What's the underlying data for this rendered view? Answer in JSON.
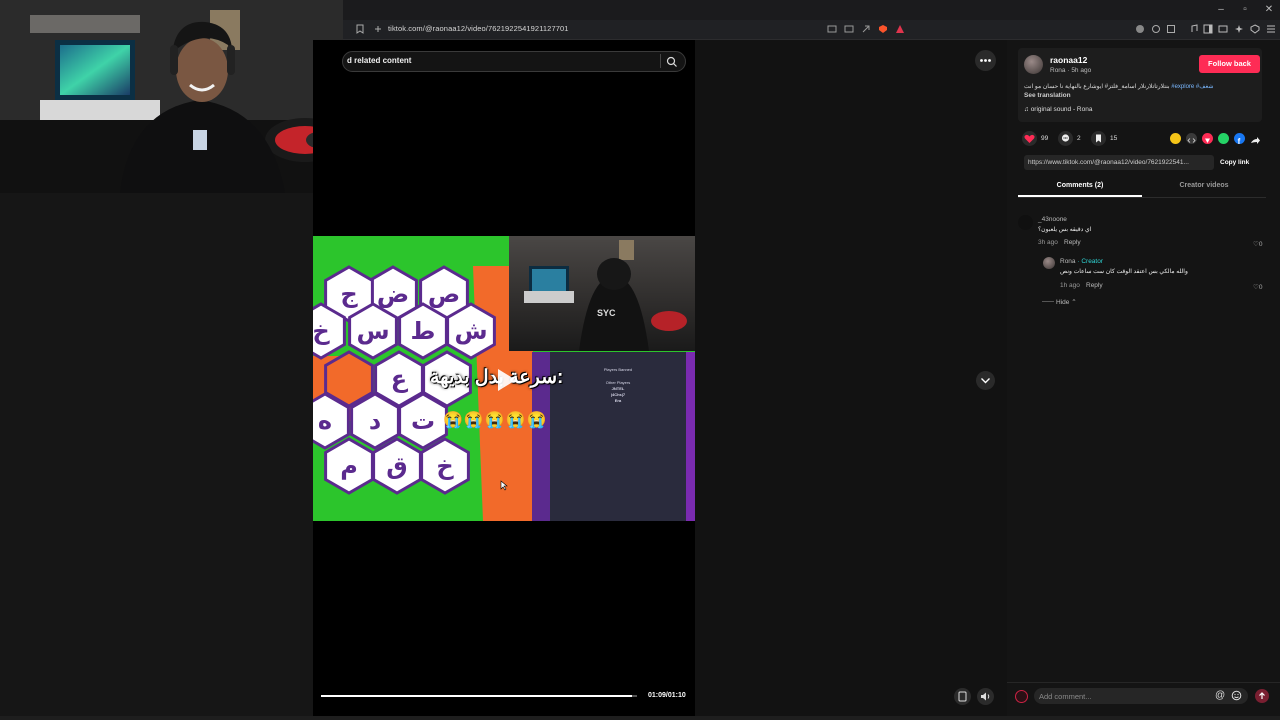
{
  "browser": {
    "url": "tiktok.com/@raonaa12/video/7621922541921127701",
    "window_controls": [
      "–",
      "▫",
      "✕"
    ]
  },
  "search": {
    "text": "d related content"
  },
  "video": {
    "caption_overlay": "سرعة بدل بديهة:",
    "emoji_row": "😭😭😭😭😭",
    "time": "01:09/01:10",
    "progress": 0.985,
    "game_letters": [
      "ض",
      "ص",
      "ج",
      "ش",
      "ط",
      "س",
      "خ",
      "ع",
      "ت",
      "د",
      "ه",
      "خ",
      "ق",
      "م"
    ],
    "players_panel": {
      "title": "Players Banned",
      "subtitle": "Other Players",
      "players": [
        "JNTEL",
        "|4Chs|7",
        "Era"
      ]
    },
    "cam_logo": "SYC"
  },
  "author": {
    "username": "raonaa12",
    "subline": "Rona · 5h ago",
    "follow_label": "Follow back",
    "description_plain": "بنتلارتاتلارنلار اسامة_فلتز# ايوشارع بالنهاية نا حسان مو انت ",
    "description_tags": "#explore #شغف",
    "see_translation": "See translation",
    "sound": "original sound - Rona"
  },
  "stats": {
    "likes": "99",
    "comments": "2",
    "saves": "15"
  },
  "share": {
    "link": "https://www.tiktok.com/@raonaa12/video/7621922541...",
    "copy_label": "Copy link",
    "colors": [
      "#f5c518",
      "#3a3a3a",
      "#fe2c55",
      "#25d366",
      "#1877f2"
    ]
  },
  "tabs": {
    "comments": "Comments (2)",
    "creator": "Creator videos"
  },
  "comments": [
    {
      "user": "_43noone",
      "text": "اي دقيقه بس يلعبون؟",
      "time": "3h ago",
      "reply_label": "Reply",
      "likes": "0"
    }
  ],
  "reply": {
    "user": "Rona",
    "creator_tag": "· Creator",
    "text": "والله مالكي بس اعتقد الوقت كان ست ساعات ونص",
    "time": "1h ago",
    "reply_label": "Reply",
    "likes": "0",
    "hide_label": "Hide"
  },
  "composer": {
    "placeholder": "Add comment..."
  },
  "colors": {
    "accent": "#fe2c55",
    "creator": "#2fd5d5",
    "hashtag": "#7ab8ff"
  }
}
